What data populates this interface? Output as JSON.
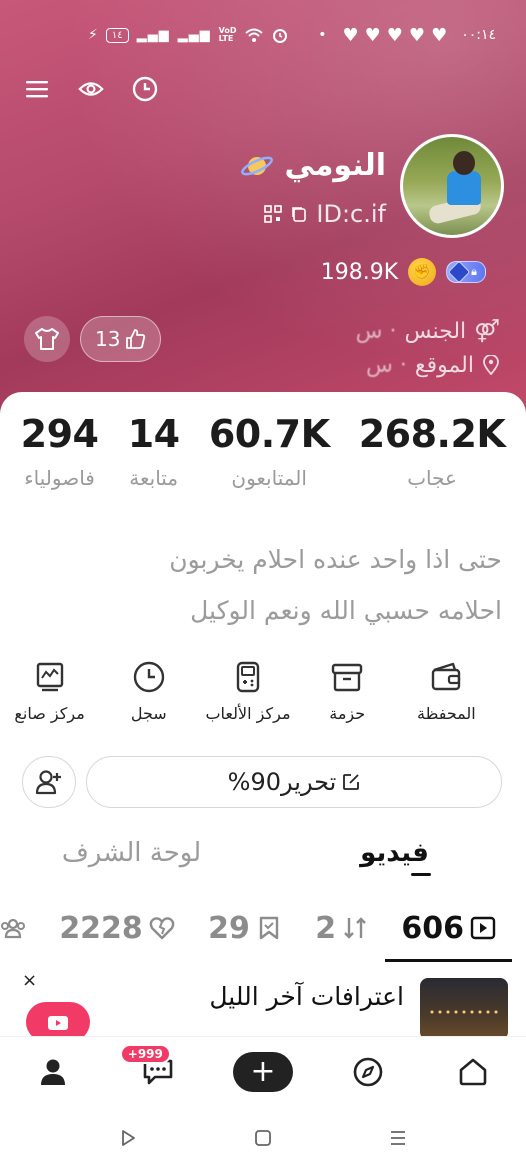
{
  "status_bar": {
    "time": "٠٠:١٤",
    "battery": "١٤",
    "network": "VoD LTE",
    "icons": [
      "heart-icon",
      "heart-icon",
      "heart-icon",
      "heart-icon",
      "heart-icon"
    ]
  },
  "top_icons": [
    "menu-icon",
    "eye-icon",
    "clock-icon"
  ],
  "profile": {
    "username": "النومي",
    "id_text": "ID:c.if",
    "coins": "198.9K",
    "likes_pill": "13",
    "info": [
      {
        "label": "الجنس",
        "value": "· س"
      },
      {
        "label": "الموقع",
        "value": "· س"
      }
    ]
  },
  "stats": [
    {
      "value": "268.2K",
      "label": "عجاب"
    },
    {
      "value": "60.7K",
      "label": "المتابعون"
    },
    {
      "value": "14",
      "label": "متابعة"
    },
    {
      "value": "294",
      "label": "فاصولياء"
    }
  ],
  "bio": {
    "line1": "حتى اذا واحد عنده احلام يخربون",
    "line2": "احلامه حسبي الله ونعم الوكيل"
  },
  "tools": [
    {
      "label": "المحفظة",
      "icon": "wallet-icon"
    },
    {
      "label": "حزمة",
      "icon": "box-icon"
    },
    {
      "label": "مركز الألعاب",
      "icon": "gamepad-icon"
    },
    {
      "label": "سجل",
      "icon": "clock-icon"
    },
    {
      "label": "مركز صانع",
      "icon": "chart-icon"
    }
  ],
  "edit_button": {
    "label": "تحرير90%"
  },
  "tabs": [
    {
      "label": "فيديو",
      "active": true
    },
    {
      "label": "لوحة الشرف",
      "active": false
    }
  ],
  "subtabs": [
    {
      "count": "606",
      "icon": "play-icon"
    },
    {
      "count": "2",
      "icon": "repost-icon"
    },
    {
      "count": "29",
      "icon": "bookmark-icon"
    },
    {
      "count": "2228",
      "icon": "heart-broken-icon"
    },
    {
      "count": "",
      "icon": "group-icon"
    }
  ],
  "promo": {
    "title": "اعترافات آخر الليل",
    "close": "×"
  },
  "bottom_nav": {
    "messages_badge": "+999"
  },
  "colors": {
    "hero_start": "#c8587a",
    "hero_end": "#a23a5c",
    "accent": "#f23a66",
    "level_badge": "#5f76f0"
  }
}
